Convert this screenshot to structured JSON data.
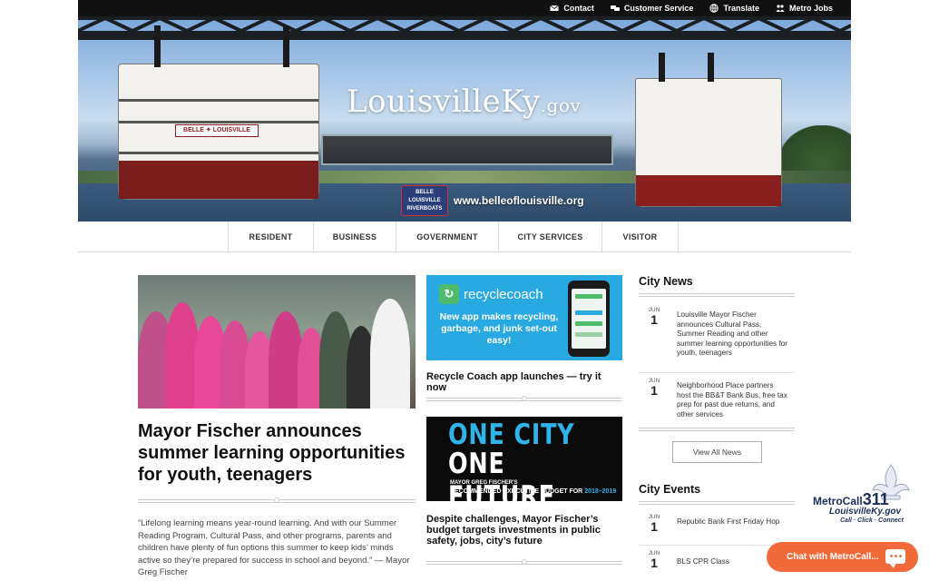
{
  "topbar": {
    "links": [
      {
        "label": "Contact",
        "icon": "envelope-icon"
      },
      {
        "label": "Customer Service",
        "icon": "chat-bubbles-icon"
      },
      {
        "label": "Translate",
        "icon": "globe-icon"
      },
      {
        "label": "Metro Jobs",
        "icon": "people-icon"
      }
    ]
  },
  "hero": {
    "logo_main": "LouisvilleKy",
    "logo_tld": ".gov",
    "search_placeholder": "",
    "boat_name": "BELLE ✦ LOUISVILLE",
    "badge_line1": "BELLE",
    "badge_line2": "LOUISVILLE",
    "badge_line3": "RIVERBOATS",
    "belle_url": "www.belleoflouisville.org"
  },
  "nav": {
    "items": [
      "RESIDENT",
      "BUSINESS",
      "GOVERNMENT",
      "CITY SERVICES",
      "VISITOR"
    ]
  },
  "feature": {
    "title": "Mayor Fischer announces summer learning opportunities for youth, teenagers",
    "quote": "“Lifelong learning means year-round learning. And with our Summer Reading Program, Cultural Pass, and other programs, parents and children have plenty of fun options this summer to keep kids’ minds active so they’re prepared for success in school and beyond.” — Mayor Greg Fischer"
  },
  "middle": {
    "rc_icon": "↻",
    "rc_name": "recyclecoach",
    "rc_text": "New app makes recycling, garbage, and junk set-out easy!",
    "rc_link": "Recycle Coach app launches — try it now",
    "ocof_line1": "ONE CITY",
    "ocof_line2": "ONE FUTURE",
    "ocof_line3": "MAYOR GREG FISCHER'S",
    "ocof_line4": "RECOMMENDED EXECUTIVE BUDGET FOR",
    "ocof_year": "2018–2019",
    "budget_link": "Despite challenges, Mayor Fischer’s budget targets investments in public safety, jobs, city’s future"
  },
  "city_news": {
    "title": "City News",
    "items": [
      {
        "month": "JUN",
        "day": "1",
        "text": "Louisville Mayor Fischer announces Cultural Pass, Summer Reading and other summer learning opportunities for youth, teenagers"
      },
      {
        "month": "JUN",
        "day": "1",
        "text": "Neighborhood Place partners host the BB&T Bank Bus, free tax prep for past due returns, and other services"
      }
    ],
    "view_all": "View All News"
  },
  "city_events": {
    "title": "City Events",
    "items": [
      {
        "month": "JUN",
        "day": "1",
        "text": "Republic Bank First Friday Hop"
      },
      {
        "month": "JUN",
        "day": "1",
        "text": "BLS CPR Class"
      }
    ]
  },
  "metrocall": {
    "title": "MetroCall",
    "number": "311",
    "site": "LouisvilleKy.gov",
    "tagline": "Call · Click · Connect",
    "chat_label": "Chat with MetroCall..."
  },
  "colors": {
    "chat_orange": "#f26a3a",
    "recycle_blue": "#29a9e1",
    "ocof_blue": "#2fb4ea",
    "metro_navy": "#1c2d5a"
  }
}
